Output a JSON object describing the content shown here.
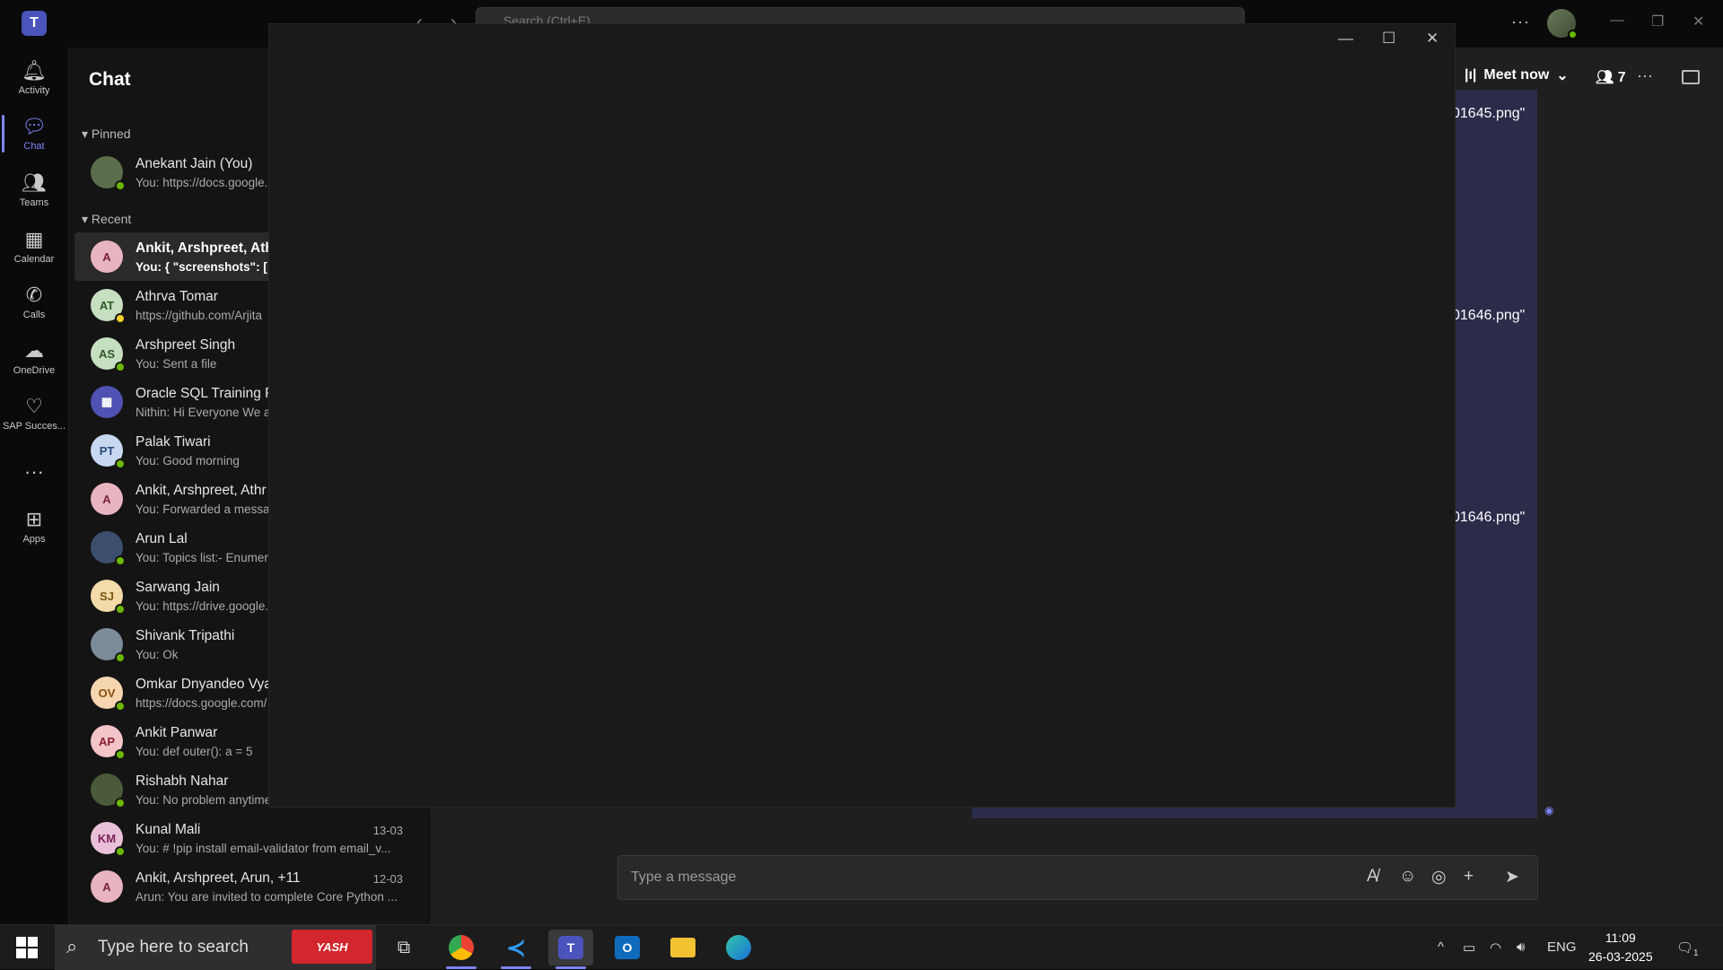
{
  "title_bar": {
    "search_placeholder": "Search (Ctrl+E)",
    "back_label": "‹",
    "forward_label": "›",
    "more_label": "···"
  },
  "rail": {
    "items": [
      {
        "label": "Activity",
        "icon": "bell-icon"
      },
      {
        "label": "Chat",
        "icon": "chat-icon"
      },
      {
        "label": "Teams",
        "icon": "teams-icon"
      },
      {
        "label": "Calendar",
        "icon": "calendar-icon"
      },
      {
        "label": "Calls",
        "icon": "phone-icon"
      },
      {
        "label": "OneDrive",
        "icon": "cloud-icon"
      },
      {
        "label": "SAP Succes...",
        "icon": "sap-icon"
      },
      {
        "label": "Apps",
        "icon": "add-apps-icon"
      }
    ],
    "more_label": "···"
  },
  "chat_list": {
    "title": "Chat",
    "pinned_label": "Pinned",
    "recent_label": "Recent",
    "pinned": [
      {
        "name": "Anekant Jain (You)",
        "preview": "You: https://docs.google.",
        "initials": "",
        "status": "online"
      }
    ],
    "recent": [
      {
        "name": "Ankit, Arshpreet, Athr",
        "preview": "You: {     \"screenshots\": [",
        "initials": "A",
        "date": ""
      },
      {
        "name": "Athrva Tomar",
        "preview": "https://github.com/Arjita",
        "initials": "AT",
        "date": ""
      },
      {
        "name": "Arshpreet Singh",
        "preview": "You: Sent a file",
        "initials": "AS",
        "date": ""
      },
      {
        "name": "Oracle SQL Training P",
        "preview": "Nithin: Hi Everyone We a",
        "initials": "",
        "date": ""
      },
      {
        "name": "Palak Tiwari",
        "preview": "You: Good morning",
        "initials": "PT",
        "date": ""
      },
      {
        "name": "Ankit, Arshpreet, Athr",
        "preview": "You: Forwarded a messag",
        "initials": "A",
        "date": ""
      },
      {
        "name": "Arun Lal",
        "preview": "You: Topics list:- Enumera",
        "initials": "",
        "date": ""
      },
      {
        "name": "Sarwang Jain",
        "preview": "You: https://drive.google.",
        "initials": "SJ",
        "date": ""
      },
      {
        "name": "Shivank Tripathi",
        "preview": "You: Ok",
        "initials": "",
        "date": ""
      },
      {
        "name": "Omkar Dnyandeo Vya",
        "preview": "https://docs.google.com/",
        "initials": "OV",
        "date": ""
      },
      {
        "name": "Ankit Panwar",
        "preview": "You: def outer():       a = 5",
        "initials": "AP",
        "date": ""
      },
      {
        "name": "Rishabh Nahar",
        "preview": "You: No problem anytime",
        "initials": "",
        "date": ""
      },
      {
        "name": "Kunal Mali",
        "preview": "You: # !pip install email-validator   from email_v...",
        "initials": "KM",
        "date": "13-03"
      },
      {
        "name": "Ankit, Arshpreet, Arun, +11",
        "preview": "Arun: You are invited to complete Core Python ...",
        "initials": "A",
        "date": "12-03"
      }
    ]
  },
  "chat_header": {
    "meet_now": "Meet now",
    "participants": "7",
    "more_label": "···"
  },
  "messages": {
    "files": [
      "01645.png\"",
      "01646.png\"",
      "01646.png\""
    ]
  },
  "composer": {
    "placeholder": "Type a message"
  },
  "taskbar": {
    "search_placeholder": "Type here to search",
    "yash_label": "YASH",
    "language": "ENG",
    "time": "11:09",
    "date": "26-03-2025",
    "notification_count": "1"
  }
}
